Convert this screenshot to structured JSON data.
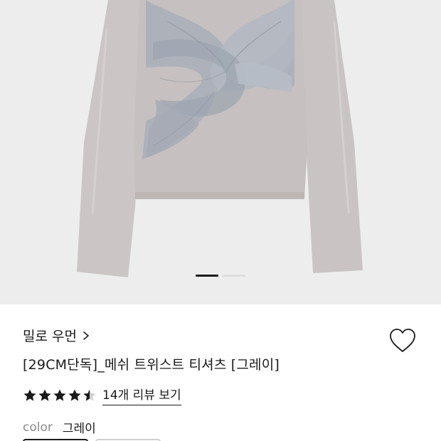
{
  "product": {
    "brand": "밀로 우먼",
    "title": "[29CM단독]_메쉬 트위스트 티셔츠 [그레이]",
    "rating": 4.5,
    "review_link": "14개 리뷰 보기",
    "color_label": "color",
    "color_value": "그레이"
  },
  "gallery": {
    "slides": 2,
    "active_slide": 1
  },
  "colors": {
    "background": "#ededed",
    "shirt": "#c8c3c2",
    "mesh": "#a7adb7",
    "text": "#1a1a1a",
    "muted": "#8a8a8a"
  },
  "icons": {
    "favorite": "heart-outline-icon",
    "brand_link": "chevron-right-icon",
    "star": "star-icon"
  }
}
